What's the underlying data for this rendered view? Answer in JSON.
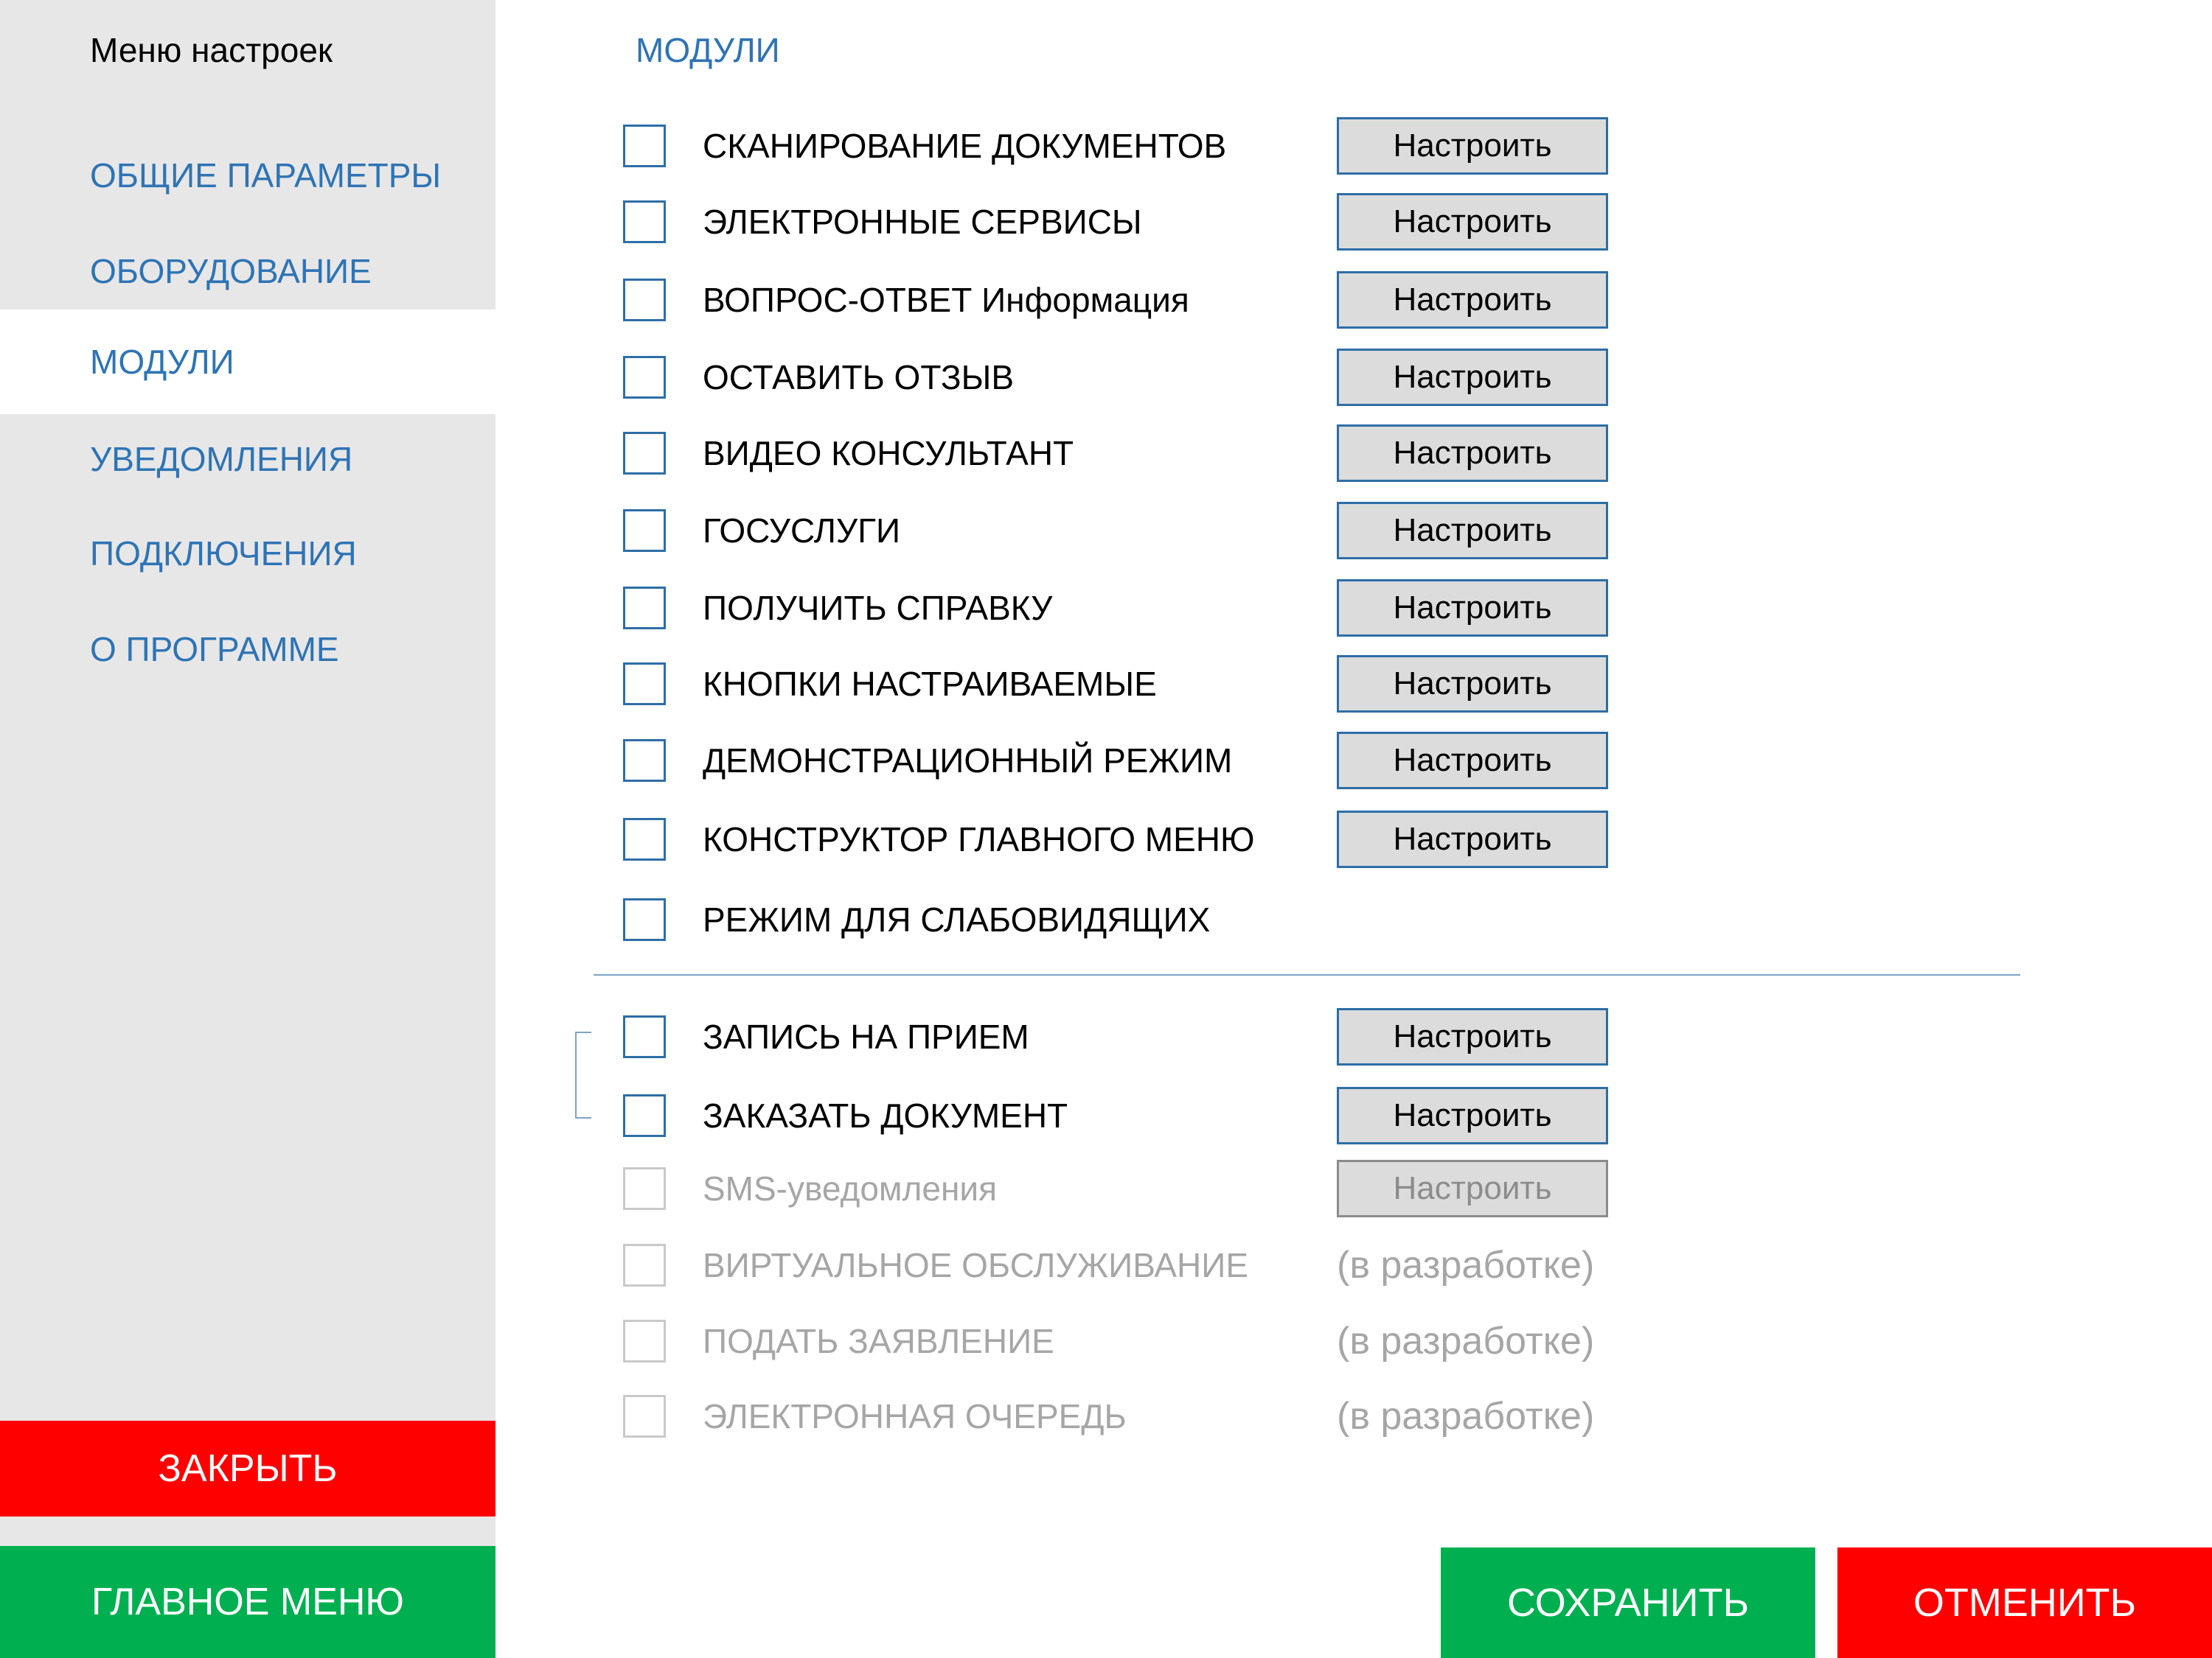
{
  "sidebar": {
    "title": "Меню настроек",
    "items": [
      {
        "label": "ОБЩИЕ ПАРАМЕТРЫ",
        "active": false
      },
      {
        "label": "ОБОРУДОВАНИЕ",
        "active": false
      },
      {
        "label": "МОДУЛИ",
        "active": true
      },
      {
        "label": "УВЕДОМЛЕНИЯ",
        "active": false
      },
      {
        "label": "ПОДКЛЮЧЕНИЯ",
        "active": false
      },
      {
        "label": "О ПРОГРАММЕ",
        "active": false
      }
    ],
    "close_label": "ЗАКРЫТЬ",
    "main_menu_label": "ГЛАВНОЕ МЕНЮ"
  },
  "main": {
    "title": "МОДУЛИ",
    "configure_label": "Настроить",
    "in_development_label": "(в разработке)",
    "modules": [
      {
        "label": "СКАНИРОВАНИЕ ДОКУМЕНТОВ",
        "checked": false,
        "disabled": false
      },
      {
        "label": "ЭЛЕКТРОННЫЕ СЕРВИСЫ",
        "checked": false,
        "disabled": false
      },
      {
        "label": "ВОПРОС-ОТВЕТ Информация",
        "checked": false,
        "disabled": false
      },
      {
        "label": "ОСТАВИТЬ ОТЗЫВ",
        "checked": false,
        "disabled": false
      },
      {
        "label": "ВИДЕО КОНСУЛЬТАНТ",
        "checked": false,
        "disabled": false
      },
      {
        "label": "ГОСУСЛУГИ",
        "checked": false,
        "disabled": false
      },
      {
        "label": "ПОЛУЧИТЬ СПРАВКУ",
        "checked": false,
        "disabled": false
      },
      {
        "label": "КНОПКИ НАСТРАИВАЕМЫЕ",
        "checked": false,
        "disabled": false
      },
      {
        "label": "ДЕМОНСТРАЦИОННЫЙ РЕЖИМ",
        "checked": false,
        "disabled": false
      },
      {
        "label": "КОНСТРУКТОР ГЛАВНОГО МЕНЮ",
        "checked": false,
        "disabled": false
      },
      {
        "label": "РЕЖИМ ДЛЯ СЛАБОВИДЯЩИХ",
        "checked": false,
        "disabled": false
      }
    ],
    "extra_modules": [
      {
        "label": "ЗАПИСЬ НА ПРИЕМ",
        "checked": false,
        "disabled": false
      },
      {
        "label": "ЗАКАЗАТЬ ДОКУМЕНТ",
        "checked": false,
        "disabled": false
      },
      {
        "label": "SMS-уведомления",
        "checked": false,
        "disabled": true
      },
      {
        "label": "ВИРТУАЛЬНОЕ ОБСЛУЖИВАНИЕ",
        "checked": false,
        "disabled": true
      },
      {
        "label": "ПОДАТЬ ЗАЯВЛЕНИЕ",
        "checked": false,
        "disabled": true
      },
      {
        "label": "ЭЛЕКТРОННАЯ ОЧЕРЕДЬ",
        "checked": false,
        "disabled": true
      }
    ]
  },
  "footer": {
    "save_label": "СОХРАНИТЬ",
    "cancel_label": "ОТМЕНИТЬ"
  }
}
